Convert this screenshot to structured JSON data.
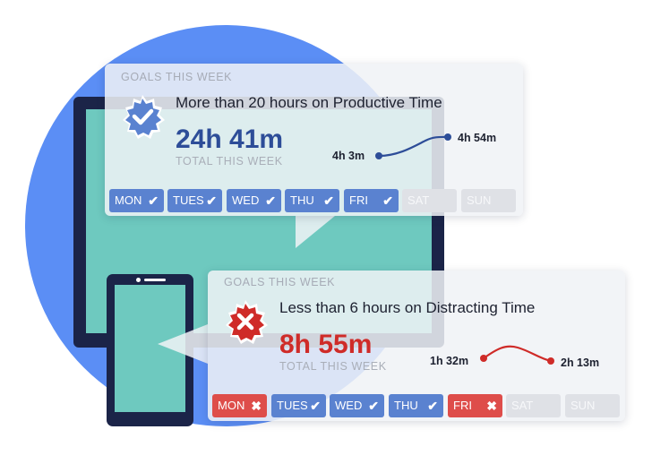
{
  "colors": {
    "blob": "#5b8ef5",
    "device": "#1b2448",
    "screen": "#6ec9bf",
    "productive": "#2d4d98",
    "distracting": "#cf2b28",
    "day_achieved": "#5a82d0",
    "day_missed": "#de4d4a",
    "day_future": "#dfe1e6"
  },
  "cards": [
    {
      "eyebrow": "GOALS THIS WEEK",
      "goal": "More than 20 hours on Productive Time",
      "badge_icon": "verified-check-badge-icon",
      "total": "24h 41m",
      "total_label": "TOTAL THIS WEEK",
      "trend": {
        "start": "4h 3m",
        "end": "4h 54m"
      },
      "days": [
        {
          "label": "MON",
          "status": "achieved",
          "mark": "✔"
        },
        {
          "label": "TUES",
          "status": "achieved",
          "mark": "✔"
        },
        {
          "label": "WED",
          "status": "achieved",
          "mark": "✔"
        },
        {
          "label": "THU",
          "status": "achieved",
          "mark": "✔"
        },
        {
          "label": "FRI",
          "status": "achieved",
          "mark": "✔"
        },
        {
          "label": "SAT",
          "status": "future",
          "mark": ""
        },
        {
          "label": "SUN",
          "status": "future",
          "mark": ""
        }
      ]
    },
    {
      "eyebrow": "GOALS THIS WEEK",
      "goal": "Less than 6 hours on Distracting Time",
      "badge_icon": "x-badge-icon",
      "total": "8h 55m",
      "total_label": "TOTAL THIS WEEK",
      "trend": {
        "start": "1h 32m",
        "end": "2h 13m"
      },
      "days": [
        {
          "label": "MON",
          "status": "missed",
          "mark": "✖"
        },
        {
          "label": "TUES",
          "status": "achieved",
          "mark": "✔"
        },
        {
          "label": "WED",
          "status": "achieved",
          "mark": "✔"
        },
        {
          "label": "THU",
          "status": "achieved",
          "mark": "✔"
        },
        {
          "label": "FRI",
          "status": "missed",
          "mark": "✖"
        },
        {
          "label": "SAT",
          "status": "future",
          "mark": ""
        },
        {
          "label": "SUN",
          "status": "future",
          "mark": ""
        }
      ]
    }
  ]
}
